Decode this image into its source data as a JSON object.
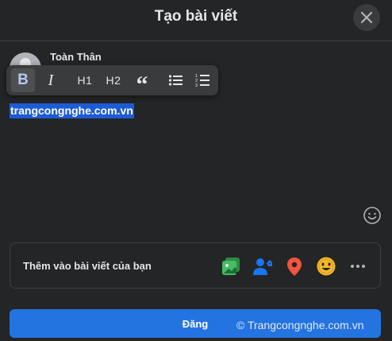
{
  "dialog": {
    "title": "Tạo bài viết",
    "close_icon": "close-icon"
  },
  "user": {
    "name": "Toàn Thân",
    "avatar_icon": "default-avatar"
  },
  "toolbar": {
    "bold": "B",
    "italic": "I",
    "h1": "H1",
    "h2": "H2",
    "quote": "“",
    "bullet_icon": "bulleted-list-icon",
    "numbered_icon": "numbered-list-icon",
    "numbered_digits": [
      "1",
      "2",
      "3"
    ]
  },
  "post": {
    "text": "trangcongnghe.com.vn",
    "selected": true
  },
  "add_to_post": {
    "label": "Thêm vào bài viết của bạn",
    "icons": [
      "photo-video-icon",
      "tag-people-icon",
      "check-in-icon",
      "feeling-activity-icon",
      "more-icon"
    ]
  },
  "submit": {
    "label": "Đăng"
  },
  "watermark": {
    "text": "© Trangcongnghe.com.vn"
  },
  "colors": {
    "background": "#242526",
    "primary": "#2374e1",
    "selection": "#1d5bd6",
    "photo": "#45bd62",
    "tag": "#1877f2",
    "location": "#f5533d",
    "feeling": "#f7b928"
  }
}
